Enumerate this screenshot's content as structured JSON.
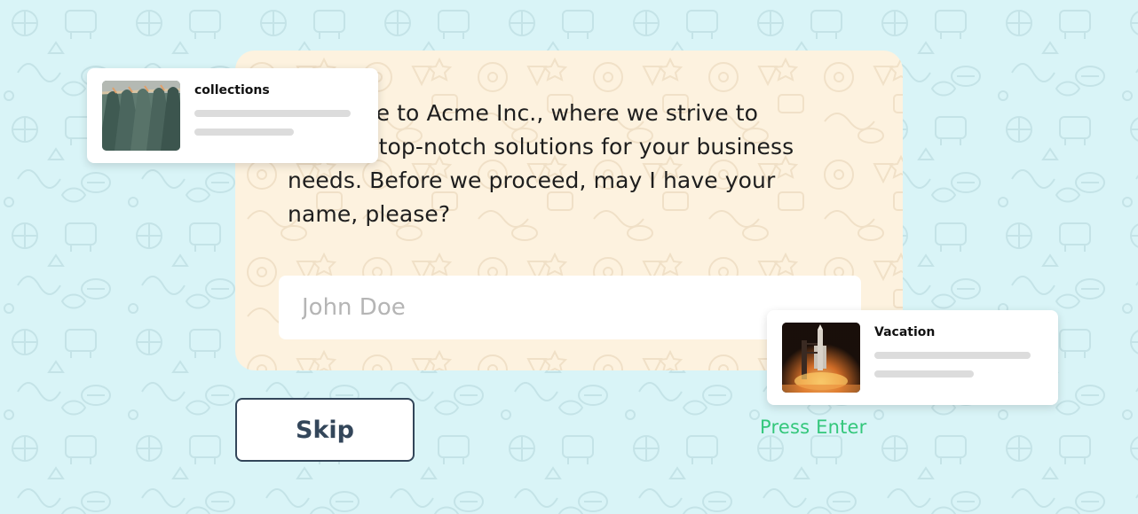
{
  "chat": {
    "message": "Welcome to Acme Inc., where we strive to provide top-notch solutions for your business needs. Before we proceed, may I have your name, please?",
    "input_placeholder": "John Doe",
    "input_value": ""
  },
  "actions": {
    "skip_label": "Skip",
    "hint": "Press Enter"
  },
  "cards": {
    "collections": {
      "title": "collections",
      "icon": "shirts-on-hangers-image"
    },
    "vacation": {
      "title": "Vacation",
      "icon": "rocket-launch-image"
    }
  },
  "colors": {
    "background": "#d9f4f7",
    "chat_bubble": "#fdf2df",
    "skip_border": "#33465a",
    "hint_text": "#34c77b",
    "placeholder": "#b5b5b5"
  }
}
